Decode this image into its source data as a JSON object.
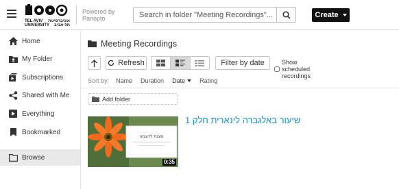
{
  "header": {
    "logo_line1": "TEL AVIV",
    "logo_line1_he": "אוניברסיטת",
    "logo_line2": "UNIVERSITY",
    "logo_line2_he": "תל-אביב",
    "powered_line1": "Powered by",
    "powered_line2": "Panopto",
    "search_placeholder": "Search in folder \"Meeting Recordings\"...",
    "create_label": "Create"
  },
  "sidebar": {
    "items": [
      {
        "label": "Home",
        "icon": "home-icon"
      },
      {
        "label": "My Folder",
        "icon": "my-folder-icon"
      },
      {
        "label": "Subscriptions",
        "icon": "subscriptions-icon"
      },
      {
        "label": "Shared with Me",
        "icon": "share-icon"
      },
      {
        "label": "Everything",
        "icon": "everything-icon"
      },
      {
        "label": "Bookmarked",
        "icon": "bookmark-icon"
      },
      {
        "label": "Browse",
        "icon": "browse-folder-icon",
        "active": true
      }
    ]
  },
  "main": {
    "folder_title": "Meeting Recordings",
    "refresh_label": "Refresh",
    "filter_label": "Filter by date",
    "show_scheduled_label": "Show scheduled recordings",
    "sort": {
      "label": "Sort by:",
      "options": [
        "Name",
        "Duration",
        "Date",
        "Rating"
      ],
      "active": "Date"
    },
    "add_folder_label": "Add folder",
    "sessions": [
      {
        "title": "שיעור באלגברה לינארית חלק 1",
        "duration": "0:35",
        "slide_text": "מצגת לדוגמה"
      }
    ]
  },
  "colors": {
    "accent_link": "#1a8fc1",
    "create_bg": "#111111",
    "flower_orange": "#f26a1b"
  }
}
